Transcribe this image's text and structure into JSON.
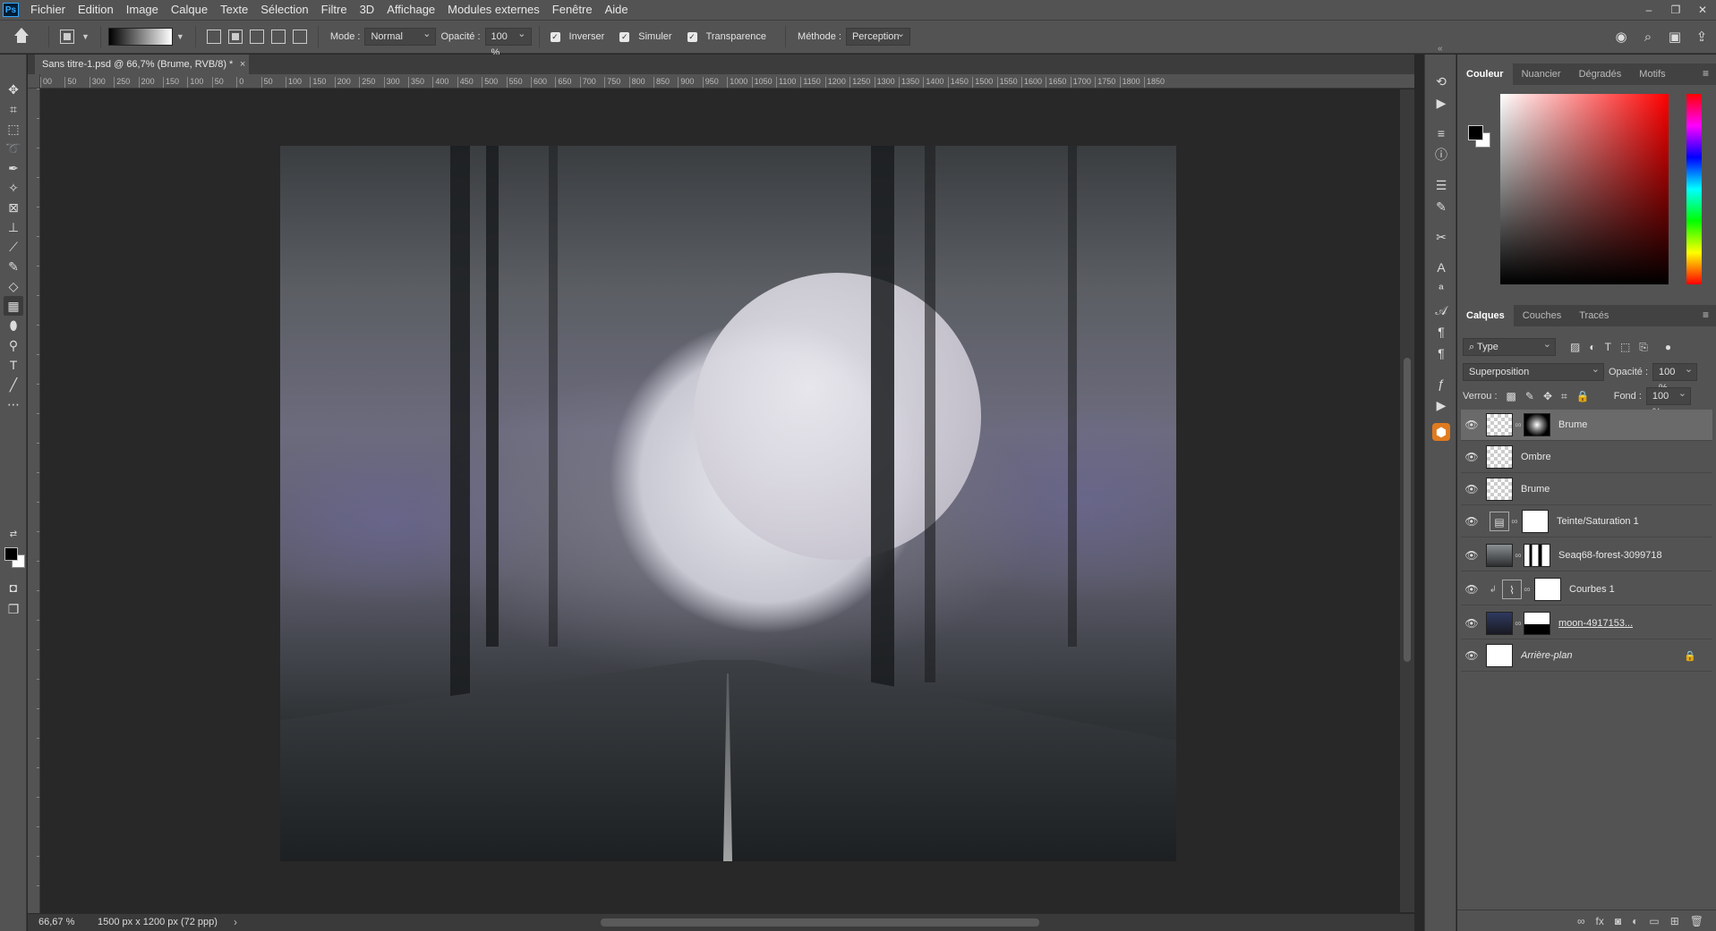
{
  "app": {
    "logo": "Ps"
  },
  "menu": [
    "Fichier",
    "Edition",
    "Image",
    "Calque",
    "Texte",
    "Sélection",
    "Filtre",
    "3D",
    "Affichage",
    "Modules externes",
    "Fenêtre",
    "Aide"
  ],
  "window_controls": [
    "–",
    "❐",
    "✕"
  ],
  "options": {
    "mode_label": "Mode :",
    "mode_value": "Normal",
    "opacity_label": "Opacité :",
    "opacity_value": "100 %",
    "inverser": "Inverser",
    "simuler": "Simuler",
    "transparence": "Transparence",
    "methode_label": "Méthode :",
    "methode_value": "Perception"
  },
  "document": {
    "tab_title": "Sans titre-1.psd @ 66,7% (Brume, RVB/8) *",
    "close": "×",
    "zoom": "66,67 %",
    "size": "1500 px x 1200 px (72 ppp)",
    "status_arrow": "›"
  },
  "ruler_ticks": [
    "00",
    "50",
    "300",
    "250",
    "200",
    "150",
    "100",
    "50",
    "0",
    "50",
    "100",
    "150",
    "200",
    "250",
    "300",
    "350",
    "400",
    "450",
    "500",
    "550",
    "600",
    "650",
    "700",
    "750",
    "800",
    "850",
    "900",
    "950",
    "1000",
    "1050",
    "1100",
    "1150",
    "1200",
    "1250",
    "1300",
    "1350",
    "1400",
    "1450",
    "1500",
    "1550",
    "1600",
    "1650",
    "1700",
    "1750",
    "1800",
    "1850"
  ],
  "color_panel": {
    "tabs": [
      "Couleur",
      "Nuancier",
      "Dégradés",
      "Motifs"
    ],
    "fg_color": "#000000",
    "bg_color": "#ffffff"
  },
  "layers_panel": {
    "tabs": [
      "Calques",
      "Couches",
      "Tracés"
    ],
    "filter_value": "Type",
    "blend_mode": "Superposition",
    "opacity_label": "Opacité :",
    "opacity_value": "100 %",
    "lock_label": "Verrou :",
    "fill_label": "Fond :",
    "fill_value": "100 %",
    "layers": [
      {
        "name": "Brume"
      },
      {
        "name": "Ombre"
      },
      {
        "name": "Brume"
      },
      {
        "name": "Teinte/Saturation 1"
      },
      {
        "name": "Seaq68-forest-3099718"
      },
      {
        "name": "Courbes 1"
      },
      {
        "name": "moon-4917153..."
      },
      {
        "name": "Arrière-plan"
      }
    ]
  }
}
